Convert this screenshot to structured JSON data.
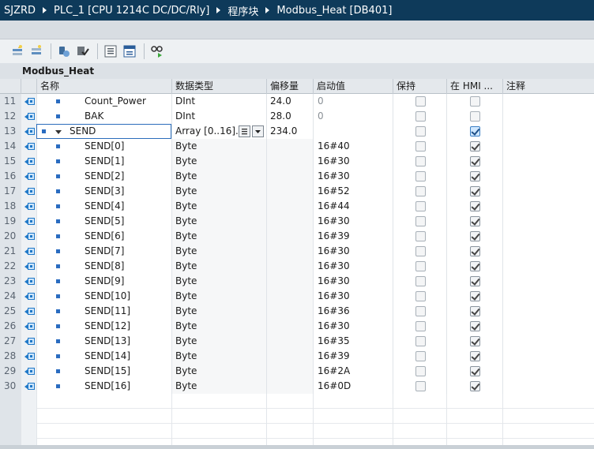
{
  "breadcrumb": [
    "SJZRD",
    "PLC_1 [CPU 1214C DC/DC/Rly]",
    "程序块",
    "Modbus_Heat [DB401]"
  ],
  "toolbar": {
    "icons": [
      "insert-row-icon",
      "add-row-icon",
      "snapshot-icon",
      "copy-snapshot-icon",
      "expand-all-icon",
      "collapse-all-icon",
      "monitor-icon"
    ]
  },
  "db_title": "Modbus_Heat",
  "columns": {
    "name": "名称",
    "datatype": "数据类型",
    "offset": "偏移量",
    "start": "启动值",
    "retain": "保持",
    "hmi": "在 HMI ...",
    "comment": "注释"
  },
  "rows": [
    {
      "num": "11",
      "name": "Count_Power",
      "datatype": "DInt",
      "offset": "24.0",
      "start": "0",
      "retain": false,
      "hmi": false,
      "level": 1
    },
    {
      "num": "12",
      "name": "BAK",
      "datatype": "DInt",
      "offset": "28.0",
      "start": "0",
      "retain": false,
      "hmi": false,
      "level": 1
    },
    {
      "num": "13",
      "name": "SEND",
      "datatype": "Array [0..16]...",
      "offset": "234.0",
      "start": "",
      "retain": false,
      "hmi": true,
      "level": 0,
      "selected": true
    },
    {
      "num": "14",
      "name": "SEND[0]",
      "datatype": "Byte",
      "offset": "",
      "start": "16#40",
      "retain": false,
      "hmi": true,
      "level": 2
    },
    {
      "num": "15",
      "name": "SEND[1]",
      "datatype": "Byte",
      "offset": "",
      "start": "16#30",
      "retain": false,
      "hmi": true,
      "level": 2
    },
    {
      "num": "16",
      "name": "SEND[2]",
      "datatype": "Byte",
      "offset": "",
      "start": "16#30",
      "retain": false,
      "hmi": true,
      "level": 2
    },
    {
      "num": "17",
      "name": "SEND[3]",
      "datatype": "Byte",
      "offset": "",
      "start": "16#52",
      "retain": false,
      "hmi": true,
      "level": 2
    },
    {
      "num": "18",
      "name": "SEND[4]",
      "datatype": "Byte",
      "offset": "",
      "start": "16#44",
      "retain": false,
      "hmi": true,
      "level": 2
    },
    {
      "num": "19",
      "name": "SEND[5]",
      "datatype": "Byte",
      "offset": "",
      "start": "16#30",
      "retain": false,
      "hmi": true,
      "level": 2
    },
    {
      "num": "20",
      "name": "SEND[6]",
      "datatype": "Byte",
      "offset": "",
      "start": "16#39",
      "retain": false,
      "hmi": true,
      "level": 2
    },
    {
      "num": "21",
      "name": "SEND[7]",
      "datatype": "Byte",
      "offset": "",
      "start": "16#30",
      "retain": false,
      "hmi": true,
      "level": 2
    },
    {
      "num": "22",
      "name": "SEND[8]",
      "datatype": "Byte",
      "offset": "",
      "start": "16#30",
      "retain": false,
      "hmi": true,
      "level": 2
    },
    {
      "num": "23",
      "name": "SEND[9]",
      "datatype": "Byte",
      "offset": "",
      "start": "16#30",
      "retain": false,
      "hmi": true,
      "level": 2
    },
    {
      "num": "24",
      "name": "SEND[10]",
      "datatype": "Byte",
      "offset": "",
      "start": "16#30",
      "retain": false,
      "hmi": true,
      "level": 2
    },
    {
      "num": "25",
      "name": "SEND[11]",
      "datatype": "Byte",
      "offset": "",
      "start": "16#36",
      "retain": false,
      "hmi": true,
      "level": 2
    },
    {
      "num": "26",
      "name": "SEND[12]",
      "datatype": "Byte",
      "offset": "",
      "start": "16#30",
      "retain": false,
      "hmi": true,
      "level": 2
    },
    {
      "num": "27",
      "name": "SEND[13]",
      "datatype": "Byte",
      "offset": "",
      "start": "16#35",
      "retain": false,
      "hmi": true,
      "level": 2
    },
    {
      "num": "28",
      "name": "SEND[14]",
      "datatype": "Byte",
      "offset": "",
      "start": "16#39",
      "retain": false,
      "hmi": true,
      "level": 2
    },
    {
      "num": "29",
      "name": "SEND[15]",
      "datatype": "Byte",
      "offset": "",
      "start": "16#2A",
      "retain": false,
      "hmi": true,
      "level": 2
    },
    {
      "num": "30",
      "name": "SEND[16]",
      "datatype": "Byte",
      "offset": "",
      "start": "16#0D",
      "retain": false,
      "hmi": true,
      "level": 2
    }
  ],
  "colors": {
    "titlebar": "#0e3a5a",
    "accent": "#2a6cc0"
  }
}
